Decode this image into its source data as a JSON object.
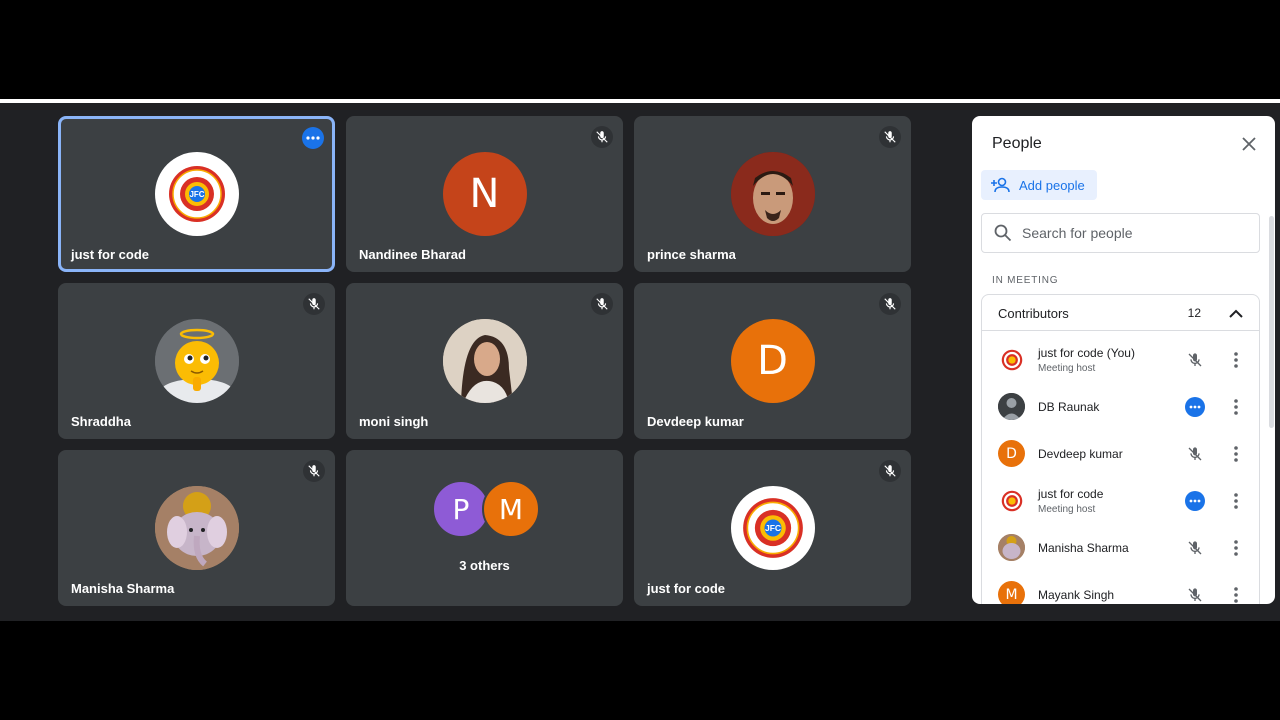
{
  "tiles": [
    {
      "name": "just for code"
    },
    {
      "name": "Nandinee Bharad",
      "initial": "N"
    },
    {
      "name": "prince sharma"
    },
    {
      "name": "Shraddha"
    },
    {
      "name": "moni singh"
    },
    {
      "name": "Devdeep kumar",
      "initial": "D"
    },
    {
      "name": "Manisha Sharma"
    },
    {
      "name": "3 others",
      "initials": [
        "P",
        "M"
      ]
    },
    {
      "name": "just for code"
    }
  ],
  "jfc_logo": {
    "text": "JFC",
    "ring": "JUST FOR CODE"
  },
  "panel": {
    "title": "People",
    "add_label": "Add people",
    "search_placeholder": "Search for people",
    "section_label": "IN MEETING",
    "contributors_label": "Contributors",
    "contributors_count": "12",
    "people": [
      {
        "name": "just for code (You)",
        "role": "Meeting host",
        "status": "muted"
      },
      {
        "name": "DB Raunak",
        "role": "",
        "status": "more"
      },
      {
        "name": "Devdeep kumar",
        "role": "",
        "status": "muted",
        "initial": "D"
      },
      {
        "name": "just for code",
        "role": "Meeting host",
        "status": "more"
      },
      {
        "name": "Manisha Sharma",
        "role": "",
        "status": "muted"
      },
      {
        "name": "Mayank Singh",
        "role": "",
        "status": "muted",
        "initial": "M"
      }
    ]
  },
  "colors": {
    "accent": "#1a73e8",
    "active_border": "#8ab4f8",
    "tile_bg": "#3c4043",
    "nandinee": "#c5441a",
    "devdeep": "#e8710a",
    "purple": "#8e5bd6",
    "orange": "#e8710a"
  }
}
